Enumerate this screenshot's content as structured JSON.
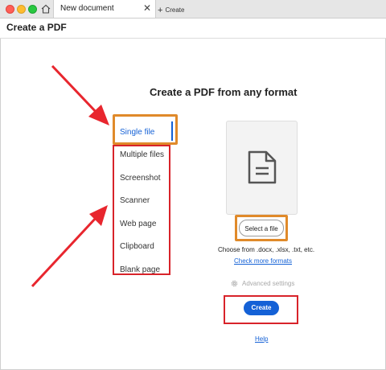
{
  "window": {
    "tab_title": "New document",
    "new_tab_label": "Create"
  },
  "header": {
    "title": "Create a PDF"
  },
  "main": {
    "heading": "Create a PDF from any format",
    "options": [
      "Single file",
      "Multiple files",
      "Screenshot",
      "Scanner",
      "Web page",
      "Clipboard",
      "Blank page"
    ],
    "selected_option": "Single file",
    "select_button_label": "Select a file",
    "choose_text": "Choose from .docx, .xlsx, .txt, etc.",
    "check_formats_link": "Check more formats",
    "advanced_settings_label": "Advanced settings",
    "create_button_label": "Create",
    "help_link": "Help"
  },
  "colors": {
    "accent": "#1461d6",
    "annotation_red": "#d8232a",
    "annotation_orange": "#e08a2a"
  },
  "icons": [
    "home-icon",
    "close-icon",
    "plus-icon",
    "document-icon",
    "gear-icon"
  ]
}
